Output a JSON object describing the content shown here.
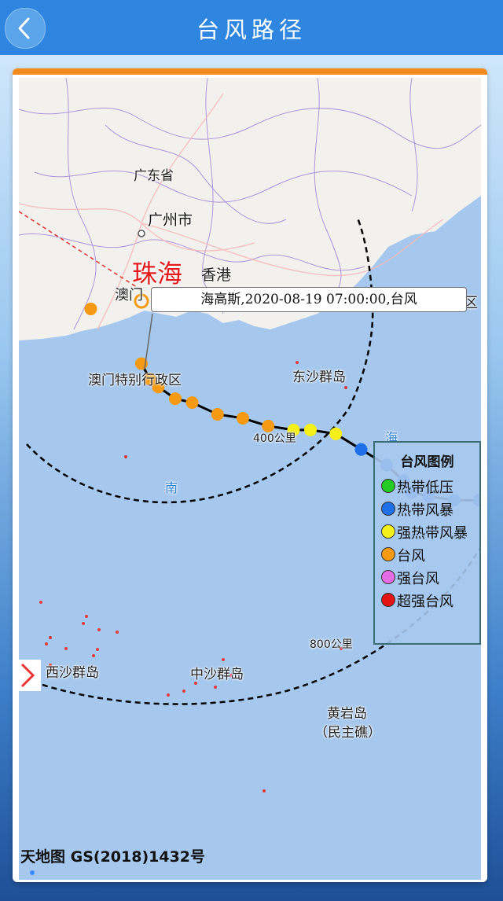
{
  "header": {
    "title": "台风路径",
    "back_icon": "chevron-left-icon"
  },
  "colors": {
    "header_bg": "#2e86e0",
    "accent_bar": "#f28a1e",
    "sea": "#a7c8ee",
    "land": "#f2f1ee",
    "track_line": "#000000",
    "forecast_line": "#e03030"
  },
  "map": {
    "labels": {
      "guangdong": "广东省",
      "guangzhou": "广州市",
      "zhuhai": "珠海",
      "hongkong": "香港",
      "macau": "澳门",
      "macau_sar": "澳门特别行政区",
      "dongsha": "东沙群岛",
      "nan": "南",
      "hai": "海",
      "xisha": "西沙群岛",
      "zhongsha": "中沙群岛",
      "huangyan": "黄岩岛",
      "minzhu": "（民主礁）",
      "qu": "区",
      "circle_400": "400公里",
      "circle_800": "800公里"
    },
    "tooltip": "海高斯,2020-08-19 07:00:00,台风",
    "attribution": "天地图 GS(2018)1432号"
  },
  "legend": {
    "title": "台风图例",
    "items": [
      {
        "label": "热带低压",
        "color": "#22cc22"
      },
      {
        "label": "热带风暴",
        "color": "#1f6fe8"
      },
      {
        "label": "强热带风暴",
        "color": "#f5ef1a"
      },
      {
        "label": "台风",
        "color": "#f59a12"
      },
      {
        "label": "强台风",
        "color": "#e66ce6"
      },
      {
        "label": "超强台风",
        "color": "#e51414"
      }
    ]
  },
  "track": {
    "typhoon_name": "海高斯",
    "points": [
      {
        "lon": 120.2,
        "lat": 18.9,
        "level": "热带低压"
      },
      {
        "lon": 119.4,
        "lat": 19.2,
        "level": "热带低压"
      },
      {
        "lon": 118.1,
        "lat": 19.6,
        "level": "热带低压"
      },
      {
        "lon": 117.8,
        "lat": 19.6,
        "level": "热带风暴"
      },
      {
        "lon": 117.5,
        "lat": 19.65,
        "level": "热带风暴"
      },
      {
        "lon": 117.0,
        "lat": 19.75,
        "level": "热带风暴"
      },
      {
        "lon": 116.7,
        "lat": 19.75,
        "level": "热带风暴"
      },
      {
        "lon": 116.4,
        "lat": 19.8,
        "level": "热带风暴"
      },
      {
        "lon": 116.2,
        "lat": 19.85,
        "level": "热带风暴"
      },
      {
        "lon": 116.1,
        "lat": 20.0,
        "level": "热带风暴"
      },
      {
        "lon": 115.9,
        "lat": 20.2,
        "level": "热带风暴"
      },
      {
        "lon": 115.6,
        "lat": 20.4,
        "level": "热带风暴"
      },
      {
        "lon": 115.3,
        "lat": 20.6,
        "level": "强热带风暴"
      },
      {
        "lon": 115.0,
        "lat": 20.65,
        "level": "强热带风暴"
      },
      {
        "lon": 114.8,
        "lat": 20.65,
        "level": "强热带风暴"
      },
      {
        "lon": 114.5,
        "lat": 20.7,
        "level": "台风"
      },
      {
        "lon": 114.2,
        "lat": 20.8,
        "level": "台风"
      },
      {
        "lon": 113.9,
        "lat": 20.85,
        "level": "台风"
      },
      {
        "lon": 113.6,
        "lat": 21.0,
        "level": "台风"
      },
      {
        "lon": 113.4,
        "lat": 21.05,
        "level": "台风"
      },
      {
        "lon": 113.2,
        "lat": 21.2,
        "level": "台风"
      },
      {
        "lon": 113.1,
        "lat": 21.3,
        "level": "台风"
      },
      {
        "lon": 113.0,
        "lat": 21.5,
        "level": "台风"
      }
    ],
    "forecast": [
      {
        "lon": 112.4,
        "lat": 22.2,
        "level": "台风"
      },
      {
        "lon": 111.2,
        "lat": 22.6,
        "level": "强热带风暴"
      }
    ]
  }
}
